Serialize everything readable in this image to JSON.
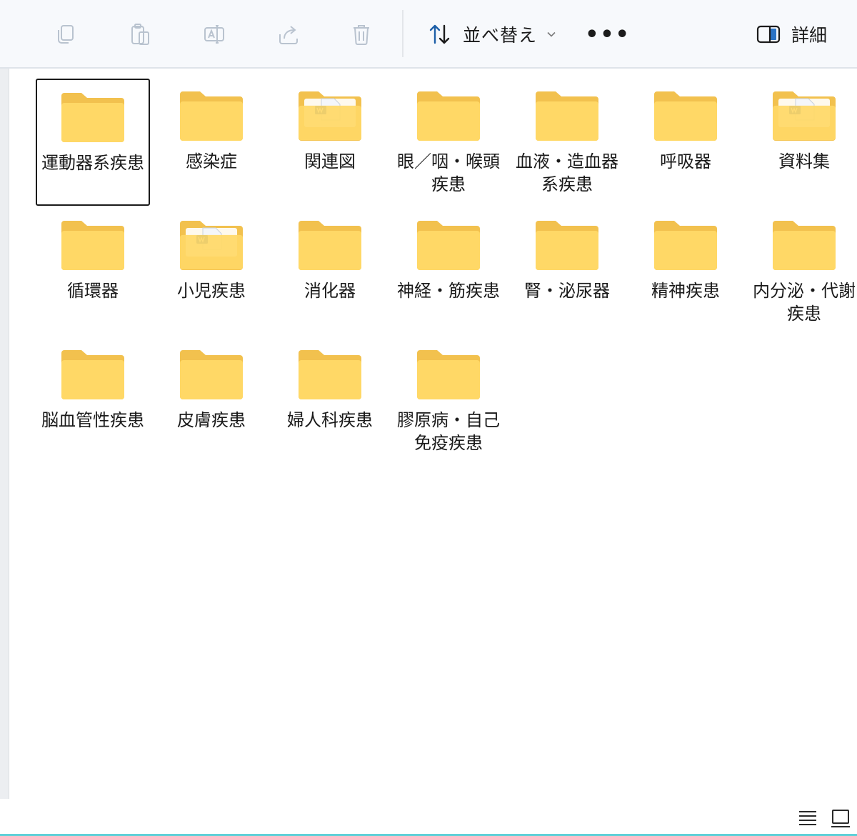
{
  "toolbar": {
    "buttons": [
      {
        "name": "copy",
        "icon": "copy-icon"
      },
      {
        "name": "paste",
        "icon": "paste-icon"
      },
      {
        "name": "rename",
        "icon": "rename-icon"
      },
      {
        "name": "share",
        "icon": "share-icon"
      },
      {
        "name": "delete",
        "icon": "trash-icon"
      }
    ],
    "sort_label": "並べ替え",
    "more_label": "•••",
    "details_label": "詳細"
  },
  "folders": [
    {
      "label": "運動器系疾患",
      "variant": "plain",
      "selected": true
    },
    {
      "label": "感染症",
      "variant": "plain",
      "selected": false
    },
    {
      "label": "関連図",
      "variant": "document",
      "selected": false
    },
    {
      "label": "眼／咽・喉頭疾患",
      "variant": "plain",
      "selected": false
    },
    {
      "label": "血液・造血器系疾患",
      "variant": "plain",
      "selected": false
    },
    {
      "label": "呼吸器",
      "variant": "plain",
      "selected": false
    },
    {
      "label": "資料集",
      "variant": "document",
      "selected": false
    },
    {
      "label": "循環器",
      "variant": "plain",
      "selected": false
    },
    {
      "label": "小児疾患",
      "variant": "document",
      "selected": false
    },
    {
      "label": "消化器",
      "variant": "plain",
      "selected": false
    },
    {
      "label": "神経・筋疾患",
      "variant": "plain",
      "selected": false
    },
    {
      "label": "腎・泌尿器",
      "variant": "plain",
      "selected": false
    },
    {
      "label": "精神疾患",
      "variant": "plain",
      "selected": false
    },
    {
      "label": "内分泌・代謝疾患",
      "variant": "plain",
      "selected": false
    },
    {
      "label": "脳血管性疾患",
      "variant": "plain",
      "selected": false
    },
    {
      "label": "皮膚疾患",
      "variant": "plain",
      "selected": false
    },
    {
      "label": "婦人科疾患",
      "variant": "plain",
      "selected": false
    },
    {
      "label": "膠原病・自己免疫疾患",
      "variant": "plain",
      "selected": false
    }
  ],
  "colors": {
    "folder_back": "#f2c14e",
    "folder_front": "#ffd866",
    "accent_status": "#5fd0d8"
  },
  "statusbar": {
    "view_buttons": [
      {
        "name": "list-view",
        "icon": "list-view-icon"
      },
      {
        "name": "tiles-view",
        "icon": "tiles-view-icon"
      }
    ]
  }
}
